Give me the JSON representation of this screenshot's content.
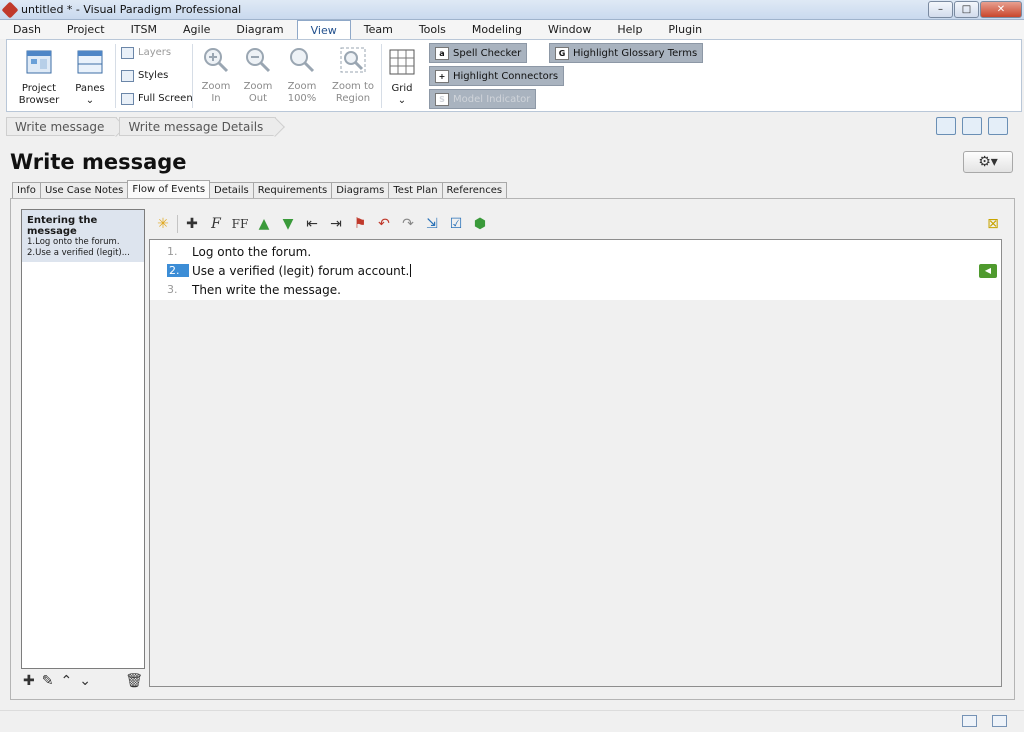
{
  "window": {
    "title": "untitled * - Visual Paradigm Professional",
    "controls": [
      "–",
      "□",
      "✕"
    ]
  },
  "menu": [
    "Dash",
    "Project",
    "ITSM",
    "Agile",
    "Diagram",
    "View",
    "Team",
    "Tools",
    "Modeling",
    "Window",
    "Help",
    "Plugin"
  ],
  "menu_active": "View",
  "ribbon": {
    "project_browser": "Project Browser",
    "panes": "Panes",
    "layers": "Layers",
    "styles": "Styles",
    "full_screen": "Full Screen",
    "zoom_in": "Zoom In",
    "zoom_out": "Zoom Out",
    "zoom_100": "Zoom 100%",
    "zoom_region": "Zoom to Region",
    "grid": "Grid",
    "spell_checker": "Spell Checker",
    "highlight_connectors": "Highlight Connectors",
    "model_indicator": "Model Indicator",
    "highlight_glossary": "Highlight Glossary Terms"
  },
  "breadcrumb": [
    "Write message",
    "Write message Details"
  ],
  "page_title": "Write message",
  "tabs": [
    "Info",
    "Use Case Notes",
    "Flow of Events",
    "Details",
    "Requirements",
    "Diagrams",
    "Test Plan",
    "References"
  ],
  "active_tab": "Flow of Events",
  "flow_list": {
    "title": "Entering the message",
    "items": [
      "1.Log onto the forum.",
      "2.Use a verified (legit)..."
    ]
  },
  "steps": [
    {
      "num": "1.",
      "text": "Log onto the forum."
    },
    {
      "num": "2.",
      "text": "Use a verified (legit) forum account."
    },
    {
      "num": "3.",
      "text": "Then write the message."
    }
  ],
  "colors": {
    "accent": "#3c8dd6",
    "flag": "#4f9a2e",
    "toggle": "#a9b3bf"
  }
}
